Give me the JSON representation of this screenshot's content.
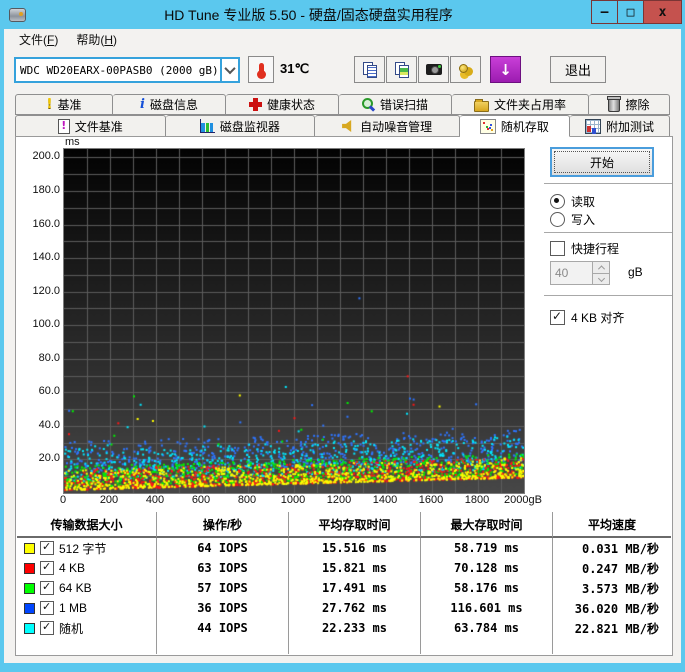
{
  "window": {
    "title": "HD Tune 专业版 5.50 - 硬盘/固态硬盘实用程序",
    "controls": {
      "minimize": "–",
      "maximize": "□",
      "close": "x"
    }
  },
  "menu": {
    "items": [
      {
        "pre": "文件(",
        "key": "F",
        "post": ")"
      },
      {
        "pre": "帮助(",
        "key": "H",
        "post": ")"
      }
    ]
  },
  "toolbar": {
    "drive": "WDC WD20EARX-00PASB0 (2000 gB)",
    "temperature": "31℃",
    "exit_label": "退出"
  },
  "tabs": {
    "row1": [
      {
        "label": "基准",
        "icon": "excl"
      },
      {
        "label": "磁盘信息",
        "icon": "info"
      },
      {
        "label": "健康状态",
        "icon": "plus"
      },
      {
        "label": "错误扫描",
        "icon": "mag"
      },
      {
        "label": "文件夹占用率",
        "icon": "folder"
      },
      {
        "label": "擦除",
        "icon": "trash"
      }
    ],
    "row2": [
      {
        "label": "文件基准",
        "icon": "fexcl"
      },
      {
        "label": "磁盘监视器",
        "icon": "bars"
      },
      {
        "label": "自动噪音管理",
        "icon": "spk"
      },
      {
        "label": "随机存取",
        "icon": "scatter",
        "active": true
      },
      {
        "label": "附加测试",
        "icon": "grid"
      }
    ]
  },
  "panel": {
    "start_label": "开始",
    "read_label": "读取",
    "write_label": "写入",
    "short_stroke_label": "快捷行程",
    "short_stroke_value": "40",
    "short_stroke_unit": "gB",
    "align_label": "4 KB 对齐"
  },
  "chart_data": {
    "type": "scatter",
    "y_unit": "ms",
    "x_unit": "gB",
    "x_axis": {
      "min": 0,
      "max": 2000,
      "grid_step": 100,
      "tick_labels": [
        "0",
        "200",
        "400",
        "600",
        "800",
        "1000",
        "1200",
        "1400",
        "1600",
        "1800",
        "2000gB"
      ]
    },
    "y_axis": {
      "min": 0,
      "max_ms": 205,
      "grid_step": 10,
      "tick_labels": [
        "200.0",
        "180.0",
        "160.0",
        "140.0",
        "120.0",
        "100.0",
        "80.0",
        "60.0",
        "40.0",
        "20.0"
      ]
    },
    "background": {
      "top": "#030303",
      "bottom": "#474747",
      "grid_color": "#5c5c5c"
    },
    "envelope": {
      "base_ms": 2,
      "rise_ms": 7.5
    },
    "draw_order": [
      3,
      4,
      2,
      1,
      0
    ],
    "series": [
      {
        "name": "512 字节",
        "color": "#ffff00",
        "stats": {
          "iops": 64,
          "avg_ms": 15.516,
          "max_ms": 58.719,
          "speed_mb_s": 0.031
        },
        "gen": {
          "n": 900,
          "lo": 0.3,
          "hi": 12,
          "pw": 1.8,
          "out_p": 0.003,
          "out_lo": 30,
          "out_hi": 55
        },
        "max_point_x": 760
      },
      {
        "name": "4 KB",
        "color": "#ff1616",
        "stats": {
          "iops": 63,
          "avg_ms": 15.821,
          "max_ms": 70.128,
          "speed_mb_s": 0.247
        },
        "gen": {
          "n": 850,
          "lo": 0.3,
          "hi": 12.5,
          "pw": 1.8,
          "out_p": 0.004,
          "out_lo": 30,
          "out_hi": 57
        },
        "max_point_x": 1490
      },
      {
        "name": "64 KB",
        "color": "#00f000",
        "stats": {
          "iops": 57,
          "avg_ms": 17.491,
          "max_ms": 58.176,
          "speed_mb_s": 3.573
        },
        "gen": {
          "n": 850,
          "lo": 2,
          "hi": 14.5,
          "pw": 1.6,
          "out_p": 0.007,
          "out_lo": 25,
          "out_hi": 56
        },
        "max_point_x": 300
      },
      {
        "name": "1 MB",
        "color": "#2e75ff",
        "stats": {
          "iops": 36,
          "avg_ms": 27.762,
          "max_ms": 116.601,
          "speed_mb_s": 36.02
        },
        "gen": {
          "n": 600,
          "lo": 10.5,
          "hi": 29,
          "pw": 1.5,
          "out_p": 0.01,
          "out_lo": 35,
          "out_hi": 58
        },
        "max_point_x": 1280
      },
      {
        "name": "随机",
        "color": "#00e8ff",
        "stats": {
          "iops": 44,
          "avg_ms": 22.233,
          "max_ms": 63.784,
          "speed_mb_s": 22.821
        },
        "gen": {
          "n": 650,
          "lo": 5.5,
          "hi": 25,
          "pw": 1.5,
          "out_p": 0.009,
          "out_lo": 28,
          "out_hi": 58
        },
        "max_point_x": 960
      }
    ]
  },
  "table": {
    "headers": [
      "传输数据大小",
      "操作/秒",
      "平均存取时间",
      "最大存取时间",
      "平均速度"
    ],
    "rows": [
      {
        "swatch": "#ffff00",
        "checked": true,
        "label": "512 字节",
        "ops": "64 IOPS",
        "avg": "15.516 ms",
        "max": "58.719 ms",
        "speed": "0.031 MB/秒"
      },
      {
        "swatch": "#ff0000",
        "checked": true,
        "label": "4 KB",
        "ops": "63 IOPS",
        "avg": "15.821 ms",
        "max": "70.128 ms",
        "speed": "0.247 MB/秒"
      },
      {
        "swatch": "#00ff00",
        "checked": true,
        "label": "64 KB",
        "ops": "57 IOPS",
        "avg": "17.491 ms",
        "max": "58.176 ms",
        "speed": "3.573 MB/秒"
      },
      {
        "swatch": "#0046ff",
        "checked": true,
        "label": "1 MB",
        "ops": "36 IOPS",
        "avg": "27.762 ms",
        "max": "116.601 ms",
        "speed": "36.020 MB/秒"
      },
      {
        "swatch": "#00ffff",
        "checked": true,
        "label": "随机",
        "ops": "44 IOPS",
        "avg": "22.233 ms",
        "max": "63.784 ms",
        "speed": "22.821 MB/秒"
      }
    ]
  }
}
